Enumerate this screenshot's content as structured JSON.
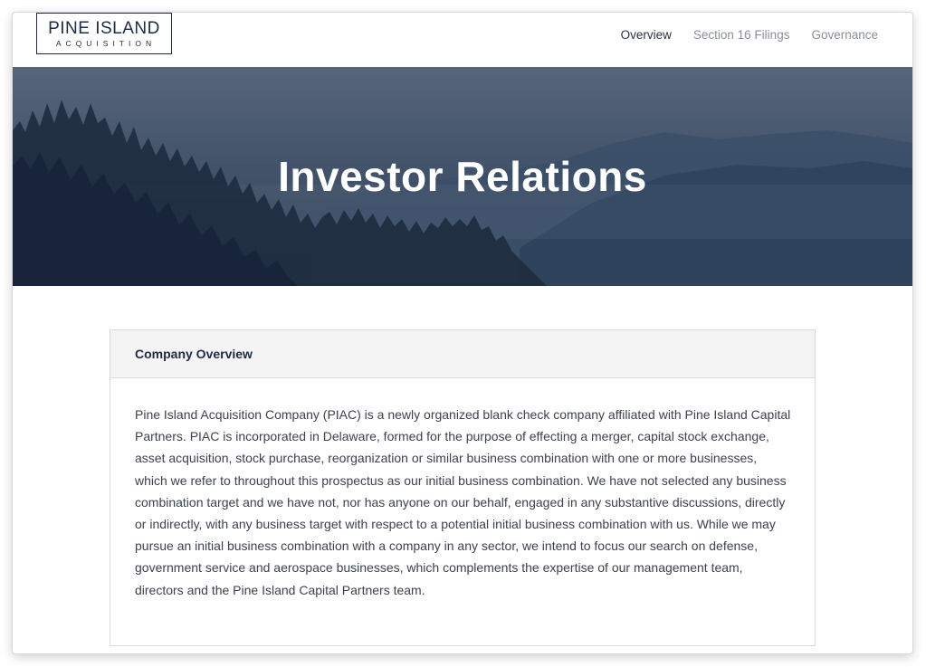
{
  "logo": {
    "main": "PINE ISLAND",
    "sub": "ACQUISITION"
  },
  "nav": {
    "overview": "Overview",
    "section16": "Section 16 Filings",
    "governance": "Governance"
  },
  "hero": {
    "title": "Investor Relations"
  },
  "overview": {
    "title": "Company Overview",
    "body": "Pine Island Acquisition Company (PIAC) is a newly organized blank check company affiliated with Pine Island Capital Partners. PIAC is incorporated in Delaware, formed for the purpose of effecting a merger, capital stock exchange, asset acquisition, stock purchase, reorganization or similar business combination with one or more businesses, which we refer to throughout this prospectus as our initial business combination. We have not selected any business combination target and we have not, nor has anyone on our behalf, engaged in any substantive discussions, directly or indirectly, with any business target with respect to a potential initial business combination with us. While we may pursue an initial business combination with a company in any sector, we intend to focus our search on defense, government service and aerospace businesses, which complements the expertise of our management team, directors and the Pine Island Capital Partners team."
  },
  "colors": {
    "navy": "#1f2a44",
    "hero_bg": "#435369"
  }
}
